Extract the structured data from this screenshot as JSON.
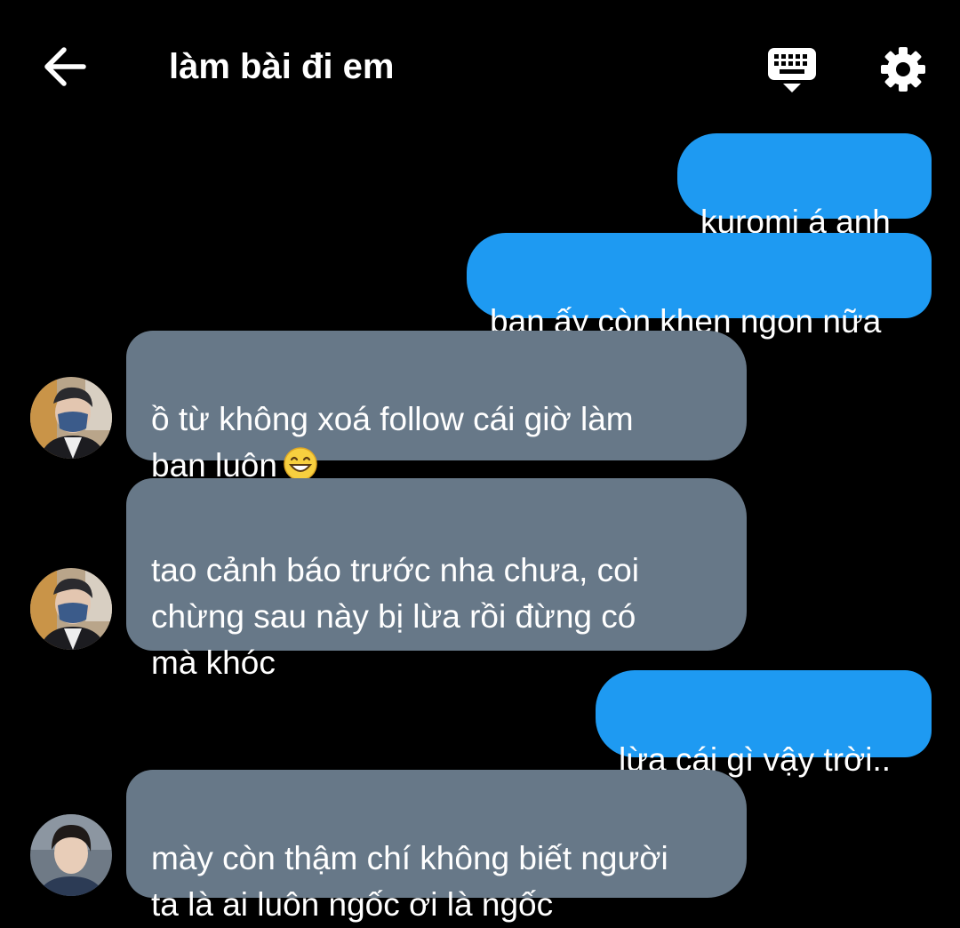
{
  "header": {
    "title": "làm bài đi em",
    "icons": [
      "back-arrow-icon",
      "keyboard-icon",
      "gear-icon"
    ]
  },
  "messages": [
    {
      "direction": "sent",
      "text": "kuromi á anh"
    },
    {
      "direction": "sent",
      "text": "bạn ấy còn khen ngon nữa"
    },
    {
      "direction": "received",
      "text": "ồ từ không xoá follow cái giờ làm\nbạn luôn",
      "emoji": "grinning-face-icon"
    },
    {
      "direction": "received",
      "text": "tao cảnh báo trước nha chưa, coi\nchừng sau này bị lừa rồi đừng có\nmà khóc"
    },
    {
      "direction": "sent",
      "text": "lừa cái gì vậy trời.."
    },
    {
      "direction": "received",
      "text": "mày còn thậm chí không biết người\nta là ai luôn ngốc ơi là ngốc"
    }
  ],
  "colors": {
    "background": "#000000",
    "sent_bubble": "#1e9af2",
    "received_bubble": "#677888",
    "text": "#ffffff"
  }
}
